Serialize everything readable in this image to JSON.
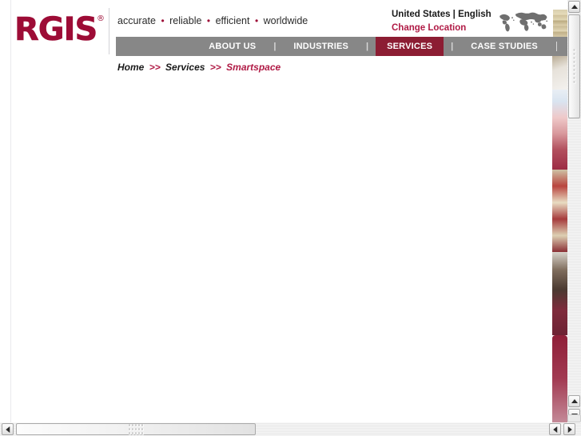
{
  "browser": {
    "vertical_scrollbar": {
      "name": "vertical-scrollbar",
      "top_button_icon": "arrow-up-icon",
      "bottom_up_button_icon": "arrow-up-icon",
      "bottom_down_button_icon": "arrow-down-icon"
    },
    "horizontal_scrollbar": {
      "name": "horizontal-scrollbar",
      "left_button_icon": "arrow-left-icon",
      "second_left_button_icon": "arrow-left-icon",
      "right_button_icon": "arrow-right-icon"
    }
  },
  "header": {
    "logo": {
      "text": "RGIS",
      "registered_mark": "®"
    },
    "tagline": {
      "words": [
        "accurate",
        "reliable",
        "efficient",
        "worldwide"
      ],
      "bullet": "•"
    },
    "locale": {
      "country_language": "United States | English",
      "change_location_label": "Change Location"
    },
    "world_map_icon": "world-map-icon"
  },
  "nav": {
    "items": [
      {
        "label": "ABOUT US",
        "active": false
      },
      {
        "label": "INDUSTRIES",
        "active": false
      },
      {
        "label": "SERVICES",
        "active": true
      },
      {
        "label": "CASE STUDIES",
        "active": false
      }
    ],
    "separator": "|"
  },
  "breadcrumb": {
    "home": "Home",
    "separator_1": ">>",
    "services": "Services",
    "separator_2": ">>",
    "current": "Smartspace"
  },
  "photo_strip": {
    "images": [
      "shelf-counter-photo",
      "hand-scanning-photo",
      "store-aisle-employee-photo",
      "employee-portrait-photo",
      "crimson-panel-photo"
    ]
  },
  "colors": {
    "brand_crimson": "#9d0c36",
    "accent_crimson": "#b01a45",
    "active_tab": "#8c1d33",
    "nav_gray": "#878787",
    "text_dark": "#1a1a1a",
    "page_background": "#ffffff"
  }
}
